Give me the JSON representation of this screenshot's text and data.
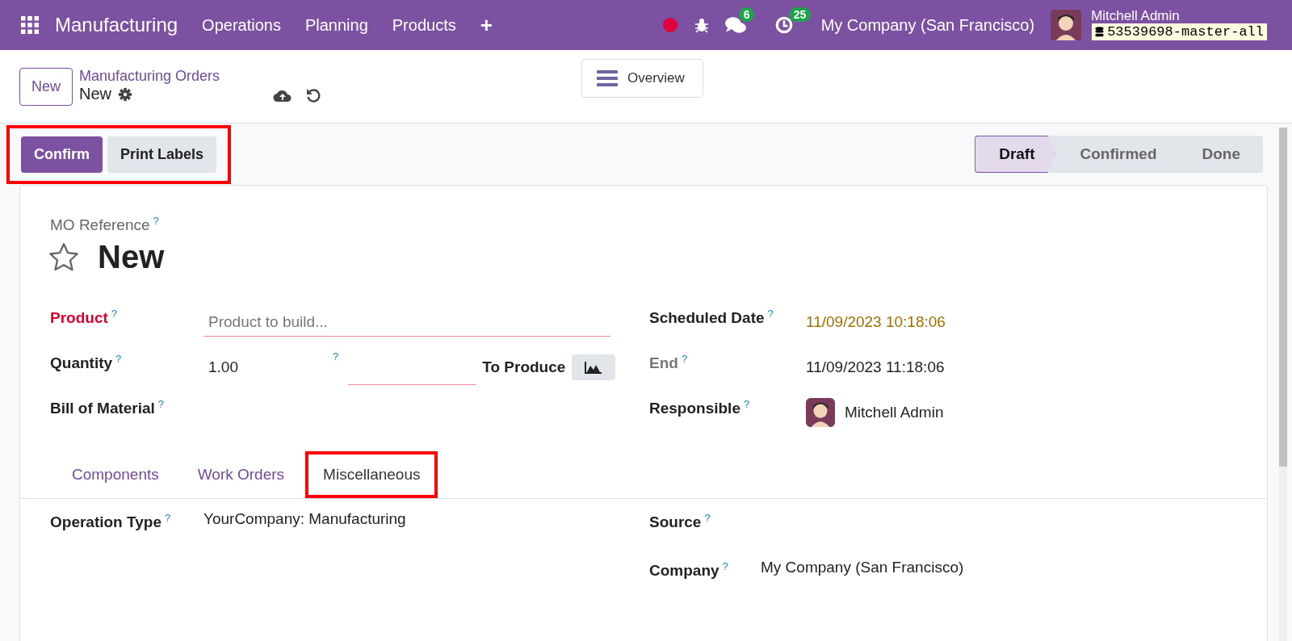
{
  "navbar": {
    "app_name": "Manufacturing",
    "menu": [
      "Operations",
      "Planning",
      "Products",
      "+"
    ],
    "chat_count": "6",
    "activity_count": "25",
    "company": "My Company (San Francisco)",
    "user": "Mitchell Admin",
    "database": "53539698-master-all"
  },
  "control_panel": {
    "new_button": "New",
    "breadcrumb": "Manufacturing Orders",
    "record": "New",
    "overview_button": "Overview"
  },
  "actions": {
    "annotated": true,
    "buttons": [
      {
        "label": "Confirm",
        "primary": true
      },
      {
        "label": "Print Labels",
        "primary": false
      }
    ]
  },
  "statusbar": [
    {
      "label": "Draft",
      "selected": true
    },
    {
      "label": "Confirmed",
      "selected": false
    },
    {
      "label": "Done",
      "selected": false
    }
  ],
  "form": {
    "reference_label": "MO Reference",
    "help": "?",
    "title": "New",
    "starred": false,
    "left_fields": [
      {
        "kind": "input",
        "label": "Product",
        "help": "?",
        "required": true,
        "muted": false,
        "placeholder": "Product to build..."
      },
      {
        "kind": "quantity",
        "label": "Quantity",
        "help": "?",
        "required": false,
        "muted": false,
        "value": "1.00",
        "uom_help": "?",
        "suffix": "To Produce"
      },
      {
        "kind": "empty",
        "label": "Bill of Material",
        "help": "?",
        "required": false,
        "muted": false
      }
    ],
    "right_fields": [
      {
        "kind": "text",
        "label": "Scheduled Date",
        "help": "?",
        "required": false,
        "muted": false,
        "value": "11/09/2023 10:18:06",
        "warning": true
      },
      {
        "kind": "text",
        "label": "End",
        "help": "?",
        "required": false,
        "muted": true,
        "value": "11/09/2023 11:18:06",
        "warning": false
      },
      {
        "kind": "user",
        "label": "Responsible",
        "help": "?",
        "required": false,
        "muted": false,
        "value": "Mitchell Admin"
      }
    ],
    "tabs": [
      {
        "label": "Components",
        "selected": false,
        "annotated": false
      },
      {
        "label": "Work Orders",
        "selected": false,
        "annotated": false
      },
      {
        "label": "Miscellaneous",
        "selected": true,
        "annotated": true
      }
    ],
    "misc_left": [
      {
        "kind": "text",
        "label": "Operation Type",
        "help": "?",
        "required": false,
        "muted": false,
        "value": "YourCompany: Manufacturing",
        "warning": false
      }
    ],
    "misc_right": [
      {
        "kind": "empty",
        "label": "Source",
        "help": "?",
        "required": false,
        "muted": false
      },
      {
        "kind": "text",
        "label": "Company",
        "help": "?",
        "required": false,
        "muted": false,
        "value": "My Company (San Francisco)",
        "warning": false
      }
    ]
  }
}
